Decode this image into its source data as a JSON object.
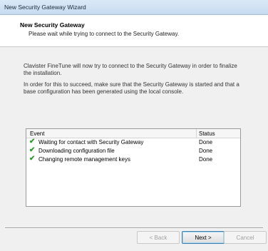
{
  "window": {
    "title": "New Security Gateway Wizard"
  },
  "header": {
    "title": "New Security Gateway",
    "subtitle": "Please wait while trying to connect to the Security Gateway."
  },
  "body": {
    "paragraph1": "Clavister FineTune will now try to connect to the Security Gateway in order to finalize the installation.",
    "paragraph2": "In order for this to succeed, make sure that the Security Gateway is started and that a base configuration has been generated using the local console."
  },
  "list": {
    "columns": [
      "Event",
      "Status"
    ],
    "rows": [
      {
        "event": "Waiting for contact with Security Gateway",
        "status": "Done",
        "icon": "check-icon"
      },
      {
        "event": "Downloading configuration file",
        "status": "Done",
        "icon": "check-icon"
      },
      {
        "event": "Changing remote management keys",
        "status": "Done",
        "icon": "check-icon"
      }
    ]
  },
  "buttons": {
    "back": "< Back",
    "next": "Next >",
    "cancel": "Cancel"
  },
  "colors": {
    "check": "#2a9a2a",
    "title_bar": "#dbe9f7"
  }
}
